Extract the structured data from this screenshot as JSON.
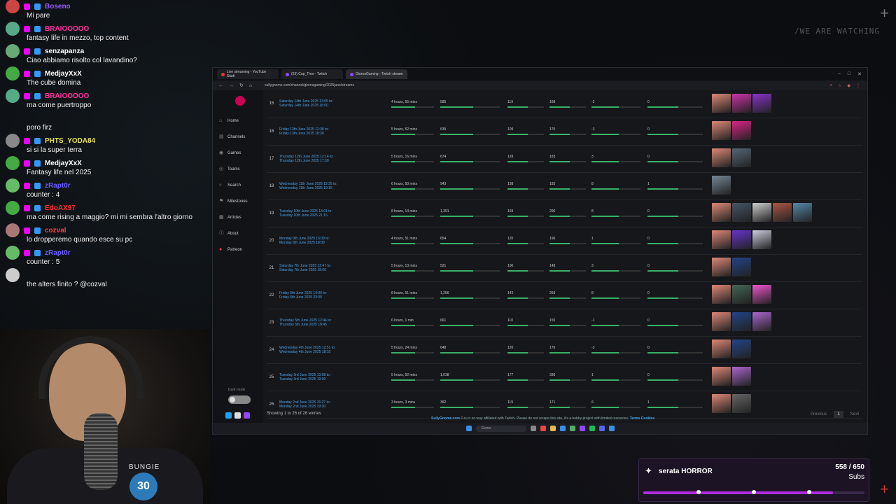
{
  "overlay": {
    "watermark": "/WE ARE WATCHING"
  },
  "chat": [
    {
      "user": "Boseno",
      "color": "#9b59ff",
      "text": "Mi pare",
      "avatar": "#c44"
    },
    {
      "user": "BRAIOOOOO",
      "color": "#ff2fa0",
      "text": "fantasy life in mezzo, top content",
      "avatar": "#5a8"
    },
    {
      "user": "senzapanza",
      "color": "#ffffff",
      "text": "Ciao abbiamo risolto col lavandino?",
      "avatar": "#6a7"
    },
    {
      "user": "MedjayXxX",
      "color": "#ffffff",
      "text": "The cube domina",
      "avatar": "#4a4"
    },
    {
      "user": "BRAIOOOOO",
      "color": "#ff2fa0",
      "text": "ma come puertroppo",
      "avatar": "#5a8"
    },
    {
      "user": "",
      "color": "#ffffff",
      "text": "poro firz",
      "avatar": ""
    },
    {
      "user": "PHTS_YODA84",
      "color": "#e8e04a",
      "text": "si si la super terra",
      "avatar": "#888"
    },
    {
      "user": "MedjayXxX",
      "color": "#ffffff",
      "text": "Fantasy life nel 2025",
      "avatar": "#4a4"
    },
    {
      "user": "zRapt0r",
      "color": "#6a5bff",
      "text": "counter : 4",
      "avatar": "#6b6"
    },
    {
      "user": "EdoAX97",
      "color": "#ff3030",
      "text": "ma come rising a maggio? mi mi sembra l'altro giorno",
      "avatar": "#4a4"
    },
    {
      "user": "cozval",
      "color": "#ff4040",
      "text": "lo dropperemo quando esce su pc",
      "avatar": "#a77"
    },
    {
      "user": "zRapt0r",
      "color": "#6a5bff",
      "text": "counter : 5",
      "avatar": "#6b6"
    },
    {
      "user": "",
      "color": "#ffffff",
      "text": "the alters finito ? @cozval",
      "avatar": "#ccc"
    }
  ],
  "browser": {
    "tabs": [
      {
        "label": "Live streaming - YouTube Studi",
        "color": "#e33"
      },
      {
        "label": "(53) Cap_Thor - Twitch",
        "color": "#9147ff"
      },
      {
        "label": "GiornoGaming - Twitch stream",
        "color": "#9147ff"
      }
    ],
    "url": "sullygnome.com/channel/giornogaming/2025june/streams",
    "nav": [
      "Home",
      "Channels",
      "Games",
      "Teams",
      "Search",
      "Milestones",
      "Articles",
      "About",
      "Patreon"
    ],
    "dark_mode_label": "Dark mode",
    "rows": [
      {
        "n": "15",
        "start": "Saturday 14th June 2025 13:05 to:",
        "end": "Saturday 14th June 2025 18:00",
        "dur": "4 hours, 55 mins",
        "v1": "585",
        "v2": "119",
        "v3": "168",
        "v4": "-2",
        "v5": "0",
        "thumbs": [
          "#d87",
          "#c3a",
          "#83c"
        ]
      },
      {
        "n": "16",
        "start": "Friday 13th June 2025 12:38 to:",
        "end": "Friday 13th June 2025 18:30",
        "dur": "5 hours, 52 mins",
        "v1": "639",
        "v2": "109",
        "v3": "170",
        "v4": "-3",
        "v5": "0",
        "thumbs": [
          "#d87",
          "#d28"
        ]
      },
      {
        "n": "17",
        "start": "Thursday 12th June 2025 12:14 to:",
        "end": "Thursday 12th June 2025 17:30",
        "dur": "5 hours, 16 mins",
        "v1": "674",
        "v2": "128",
        "v3": "183",
        "v4": "3",
        "v5": "0",
        "thumbs": [
          "#d87",
          "#567"
        ]
      },
      {
        "n": "18",
        "start": "Wednesday 11th June 2025 12:25 to:",
        "end": "Wednesday 11th June 2025 19:15",
        "dur": "6 hours, 50 mins",
        "v1": "943",
        "v2": "138",
        "v3": "183",
        "v4": "8",
        "v5": "1",
        "thumbs": [
          "#789"
        ]
      },
      {
        "n": "19",
        "start": "Tuesday 10th June 2025 13:01 to:",
        "end": "Tuesday 10th June 2025 21:15",
        "dur": "8 hours, 14 mins",
        "v1": "1,391",
        "v2": "169",
        "v3": "290",
        "v4": "8",
        "v5": "0",
        "thumbs": [
          "#d87",
          "#456",
          "#ccc",
          "#a54",
          "#58a"
        ]
      },
      {
        "n": "20",
        "start": "Monday 9th June 2025 13:09 to:",
        "end": "Monday 9th June 2025 18:00",
        "dur": "4 hours, 51 mins",
        "v1": "654",
        "v2": "135",
        "v3": "196",
        "v4": "1",
        "v5": "0",
        "thumbs": [
          "#d87",
          "#63c",
          "#ccd"
        ]
      },
      {
        "n": "21",
        "start": "Saturday 7th June 2025 12:47 to:",
        "end": "Saturday 7th June 2025 18:00",
        "dur": "5 hours, 13 mins",
        "v1": "521",
        "v2": "100",
        "v3": "148",
        "v4": "3",
        "v5": "0",
        "thumbs": [
          "#d87",
          "#248"
        ]
      },
      {
        "n": "22",
        "start": "Friday 6th June 2025 14:09 to:",
        "end": "Friday 6th June 2025 23:00",
        "dur": "8 hours, 51 mins",
        "v1": "1,256",
        "v2": "142",
        "v3": "269",
        "v4": "8",
        "v5": "0",
        "thumbs": [
          "#d87",
          "#465",
          "#e5c"
        ]
      },
      {
        "n": "23",
        "start": "Thursday 5th June 2025 12:44 to:",
        "end": "Thursday 5th June 2025 18:45",
        "dur": "6 hours, 1 min",
        "v1": "661",
        "v2": "110",
        "v3": "155",
        "v4": "-1",
        "v5": "0",
        "thumbs": [
          "#d87",
          "#248",
          "#a6c"
        ]
      },
      {
        "n": "24",
        "start": "Wednesday 4th June 2025 12:51 to:",
        "end": "Wednesday 4th June 2025 18:15",
        "dur": "5 hours, 24 mins",
        "v1": "648",
        "v2": "120",
        "v3": "176",
        "v4": "-3",
        "v5": "0",
        "thumbs": [
          "#d87",
          "#248"
        ]
      },
      {
        "n": "25",
        "start": "Tuesday 3rd June 2025 13:08 to:",
        "end": "Tuesday 3rd June 2025 19:00",
        "dur": "5 hours, 52 mins",
        "v1": "1,038",
        "v2": "177",
        "v3": "336",
        "v4": "1",
        "v5": "0",
        "thumbs": [
          "#d87",
          "#a6c"
        ]
      },
      {
        "n": "26",
        "start": "Monday 2nd June 2025 16:27 to:",
        "end": "Monday 2nd June 2025 19:30",
        "dur": "3 hours, 3 mins",
        "v1": "362",
        "v2": "119",
        "v3": "171",
        "v4": "6",
        "v5": "1",
        "thumbs": [
          "#d87",
          "#666"
        ]
      }
    ],
    "showing": "Showing 1 to 26 of 26 entries",
    "pager": {
      "prev": "Previous",
      "page": "1",
      "next": "Next"
    },
    "credit_site": "SullyGnome.com",
    "credit_text": "© is in no way affiliated with Twitch. Please do not scrape this site, it's a hobby project with limited resources.",
    "credit_links": "Terms Cookies",
    "taskbar_search": "Cerca"
  },
  "cam": {
    "logo": "BUNGIE",
    "badge": "30"
  },
  "subgoal": {
    "title": "serata HORROR",
    "count": "558 / 650",
    "unit": "Subs",
    "progress": 0.858,
    "color": "#b02be0"
  }
}
